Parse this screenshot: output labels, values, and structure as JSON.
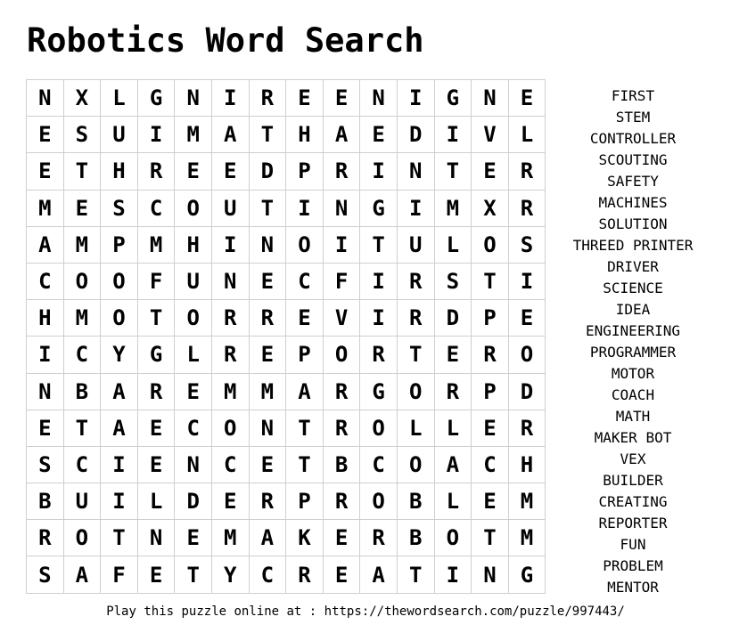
{
  "title": "Robotics Word Search",
  "grid": [
    [
      "N",
      "X",
      "L",
      "G",
      "N",
      "I",
      "R",
      "E",
      "E",
      "N",
      "I",
      "G",
      "N",
      "E"
    ],
    [
      "E",
      "S",
      "U",
      "I",
      "M",
      "A",
      "T",
      "H",
      "A",
      "E",
      "D",
      "I",
      "V",
      "L"
    ],
    [
      "E",
      "T",
      "H",
      "R",
      "E",
      "E",
      "D",
      "P",
      "R",
      "I",
      "N",
      "T",
      "E",
      "R"
    ],
    [
      "M",
      "E",
      "S",
      "C",
      "O",
      "U",
      "T",
      "I",
      "N",
      "G",
      "I",
      "M",
      "X",
      "R"
    ],
    [
      "A",
      "M",
      "P",
      "M",
      "H",
      "I",
      "N",
      "O",
      "I",
      "T",
      "U",
      "L",
      "O",
      "S"
    ],
    [
      "C",
      "O",
      "O",
      "F",
      "U",
      "N",
      "E",
      "C",
      "F",
      "I",
      "R",
      "S",
      "T",
      "I"
    ],
    [
      "H",
      "M",
      "O",
      "T",
      "O",
      "R",
      "R",
      "E",
      "V",
      "I",
      "R",
      "D",
      "P",
      "E"
    ],
    [
      "I",
      "C",
      "Y",
      "G",
      "L",
      "R",
      "E",
      "P",
      "O",
      "R",
      "T",
      "E",
      "R",
      "O"
    ],
    [
      "N",
      "B",
      "A",
      "R",
      "E",
      "M",
      "M",
      "A",
      "R",
      "G",
      "O",
      "R",
      "P",
      "D"
    ],
    [
      "E",
      "T",
      "A",
      "E",
      "C",
      "O",
      "N",
      "T",
      "R",
      "O",
      "L",
      "L",
      "E",
      "R"
    ],
    [
      "S",
      "C",
      "I",
      "E",
      "N",
      "C",
      "E",
      "T",
      "B",
      "C",
      "O",
      "A",
      "C",
      "H"
    ],
    [
      "B",
      "U",
      "I",
      "L",
      "D",
      "E",
      "R",
      "P",
      "R",
      "O",
      "B",
      "L",
      "E",
      "M"
    ],
    [
      "R",
      "O",
      "T",
      "N",
      "E",
      "M",
      "A",
      "K",
      "E",
      "R",
      "B",
      "O",
      "T",
      "M"
    ],
    [
      "S",
      "A",
      "F",
      "E",
      "T",
      "Y",
      "C",
      "R",
      "E",
      "A",
      "T",
      "I",
      "N",
      "G"
    ]
  ],
  "words": [
    "FIRST",
    "STEM",
    "CONTROLLER",
    "SCOUTING",
    "SAFETY",
    "MACHINES",
    "SOLUTION",
    "THREED PRINTER",
    "DRIVER",
    "SCIENCE",
    "IDEA",
    "ENGINEERING",
    "PROGRAMMER",
    "MOTOR",
    "COACH",
    "MATH",
    "MAKER BOT",
    "VEX",
    "BUILDER",
    "CREATING",
    "REPORTER",
    "FUN",
    "PROBLEM",
    "MENTOR"
  ],
  "footer": "Play this puzzle online at : https://thewordsearch.com/puzzle/997443/"
}
